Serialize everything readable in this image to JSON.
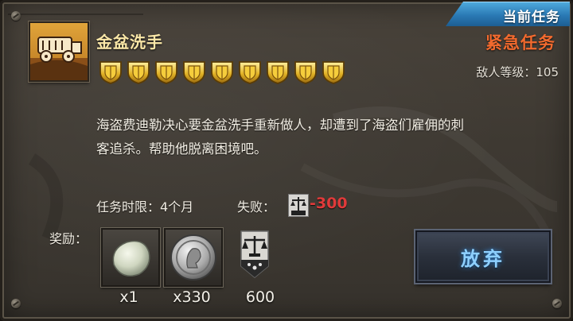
{
  "header": {
    "current_tab": "当前任务",
    "mission_type": "紧急任务",
    "enemy_level_label": "敌人等级：",
    "enemy_level_value": "105"
  },
  "mission": {
    "title": "金盆洗手",
    "difficulty_shields": 9,
    "description_line1": "海盗费迪勒决心要金盆洗手重新做人，却遭到了海盗们雇佣的刺",
    "description_line2": "客追杀。帮助他脱离困境吧。",
    "time_limit": "任务时限：4个月",
    "fail_label": "失败：",
    "fail_value": "-300"
  },
  "rewards": {
    "label": "奖励：",
    "items": [
      {
        "icon": "stone-icon",
        "qty": "x1"
      },
      {
        "icon": "silver-coin-icon",
        "qty": "x330"
      },
      {
        "icon": "reputation-scales-icon",
        "qty": "600"
      }
    ]
  },
  "actions": {
    "abandon_label": "放弃"
  },
  "colors": {
    "urgent": "#f26a2e",
    "fail_value": "#e03a3a",
    "title": "#fbe8a8",
    "tab": "#2a79b4",
    "button_text": "#8ed0ff"
  }
}
